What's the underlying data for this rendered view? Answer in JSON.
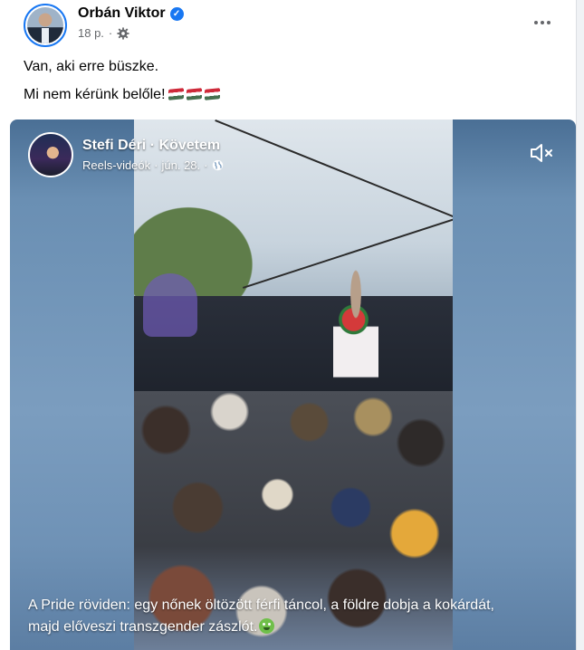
{
  "post": {
    "author": "Orbán Viktor",
    "time": "18 p.",
    "time_separator": "·",
    "text_line1": "Van, aki erre büszke.",
    "text_line2": "Mi nem kérünk belőle!"
  },
  "reel": {
    "author": "Stefi Déri",
    "separator": "·",
    "follow_label": "Követem",
    "source": "Reels-videók",
    "date": "jún. 28.",
    "caption": "A Pride röviden: egy nőnek öltözött férfi táncol, a földre dobja a kokárdát, majd előveszi transzgender zászlót."
  },
  "icons": {
    "verified": "verified-badge-icon",
    "privacy": "gear-icon",
    "more": "more-options-icon",
    "flag": "hungarian-flag-emoji",
    "globe": "globe-icon",
    "mute": "speaker-muted-icon",
    "emoji": "nauseated-face-emoji"
  },
  "colors": {
    "brand_blue": "#1877f2",
    "secondary_text": "#65676b"
  }
}
